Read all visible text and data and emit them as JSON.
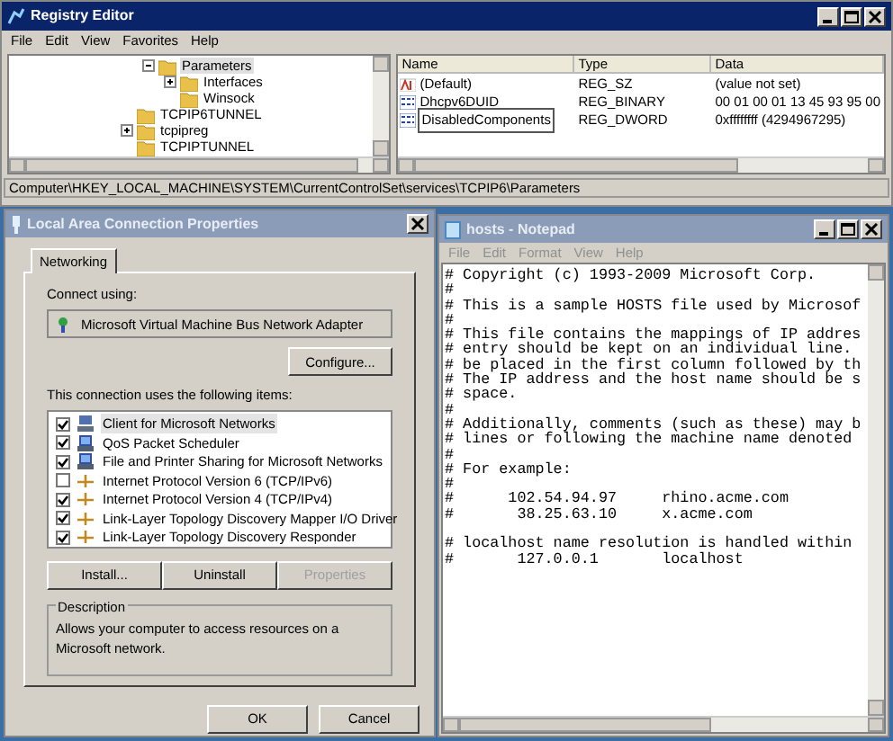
{
  "registry": {
    "title": "Registry Editor",
    "menu": [
      "File",
      "Edit",
      "View",
      "Favorites",
      "Help"
    ],
    "tree": [
      {
        "children": [
          {
            "label": "Parameters",
            "expanded": true,
            "selected": true,
            "children": [
              {
                "label": "Interfaces",
                "expanded": false,
                "selected": false
              },
              {
                "label": "Winsock",
                "selected": false
              }
            ]
          }
        ]
      },
      {
        "label": "TCPIP6TUNNEL",
        "selected": false
      },
      {
        "label": "tcpipreg",
        "expanded": false,
        "selected": false
      },
      {
        "label": "TCPIPTUNNEL",
        "selected": false
      }
    ],
    "columns": [
      "Name",
      "Type",
      "Data"
    ],
    "rows": [
      {
        "kind": "string",
        "editing": false,
        "cells": [
          "(Default)",
          "REG_SZ",
          "(value not set)"
        ]
      },
      {
        "kind": "binary",
        "editing": false,
        "cells": [
          "Dhcpv6DUID",
          "REG_BINARY",
          "00 01 00 01 13 45 93 95 00"
        ]
      },
      {
        "kind": "binary",
        "editing": true,
        "cells": [
          "DisabledComponents",
          "REG_DWORD",
          "0xffffffff (4294967295)"
        ]
      }
    ],
    "status_bar": "Computer\\HKEY_LOCAL_MACHINE\\SYSTEM\\CurrentControlSet\\services\\TCPIP6\\Parameters"
  },
  "dialog": {
    "title": "Local Area Connection Properties",
    "tabs": [
      {
        "label": "Networking",
        "selected": true
      }
    ],
    "connect_label": "Connect using:",
    "adapter": "Microsoft Virtual Machine Bus Network Adapter",
    "configure": "Configure...",
    "items_label": "This connection uses the following items:",
    "items": [
      {
        "kind": "client",
        "label": "Client for Microsoft Networks",
        "checked": true,
        "selected": true
      },
      {
        "kind": "service",
        "label": "QoS Packet Scheduler",
        "checked": true,
        "selected": false
      },
      {
        "kind": "service",
        "label": "File and Printer Sharing for Microsoft Networks",
        "checked": true,
        "selected": false
      },
      {
        "kind": "protocol",
        "label": "Internet Protocol Version 6 (TCP/IPv6)",
        "checked": false,
        "selected": false
      },
      {
        "kind": "protocol",
        "label": "Internet Protocol Version 4 (TCP/IPv4)",
        "checked": true,
        "selected": false
      },
      {
        "kind": "protocol",
        "label": "Link-Layer Topology Discovery Mapper I/O Driver",
        "checked": true,
        "selected": false
      },
      {
        "kind": "protocol",
        "label": "Link-Layer Topology Discovery Responder",
        "checked": true,
        "selected": false
      }
    ],
    "item_buttons": [
      {
        "label": "Install...",
        "disabled": false
      },
      {
        "label": "Uninstall",
        "disabled": false
      },
      {
        "label": "Properties",
        "disabled": true
      }
    ],
    "description_title": "Description",
    "description": "Allows your computer to access resources on a Microsoft network.",
    "buttons": [
      "OK",
      "Cancel"
    ]
  },
  "notepad": {
    "title": "hosts - Notepad",
    "menu": [
      "File",
      "Edit",
      "Format",
      "View",
      "Help"
    ],
    "lines": [
      {
        "kind": "text",
        "text": "# Copyright (c) 1993-2009 Microsoft Corp."
      },
      {
        "kind": "text",
        "text": "#"
      },
      {
        "kind": "text",
        "text": "# This is a sample HOSTS file used by Microsof"
      },
      {
        "kind": "text",
        "text": "#"
      },
      {
        "kind": "text",
        "text": "# This file contains the mappings of IP addres"
      },
      {
        "kind": "text",
        "text": "# entry should be kept on an individual line."
      },
      {
        "kind": "text",
        "text": "# be placed in the first column followed by th"
      },
      {
        "kind": "text",
        "text": "# The IP address and the host name should be s"
      },
      {
        "kind": "text",
        "text": "# space."
      },
      {
        "kind": "text",
        "text": "#"
      },
      {
        "kind": "text",
        "text": "# Additionally, comments (such as these) may b"
      },
      {
        "kind": "text",
        "text": "# lines or following the machine name denoted"
      },
      {
        "kind": "text",
        "text": "#"
      },
      {
        "kind": "text",
        "text": "# For example:"
      },
      {
        "kind": "text",
        "text": "#"
      },
      {
        "kind": "text",
        "text": "#      102.54.94.97     rhino.acme.com"
      },
      {
        "kind": "text",
        "text": "#       38.25.63.10     x.acme.com"
      },
      {
        "kind": "blank"
      },
      {
        "kind": "text",
        "text": "# localhost name resolution is handled within"
      },
      {
        "kind": "text",
        "text": "#       127.0.0.1       localhost"
      }
    ]
  }
}
